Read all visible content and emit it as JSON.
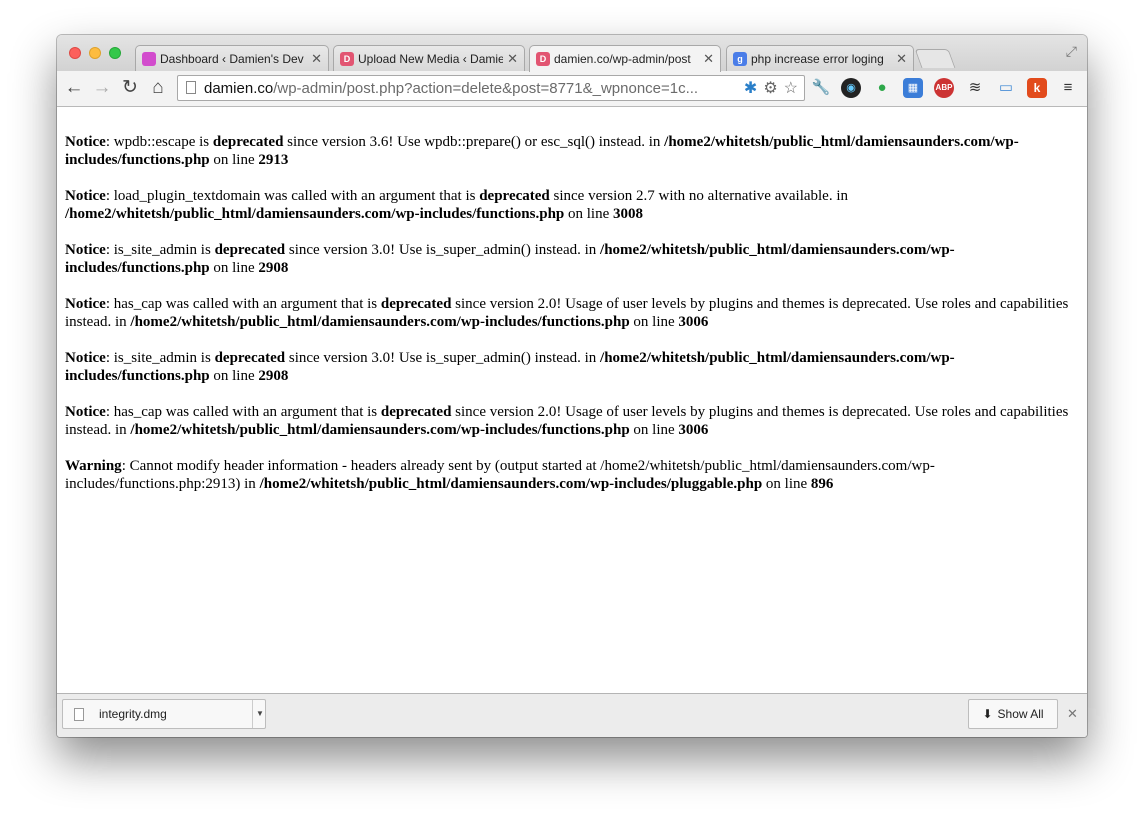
{
  "tabs": [
    {
      "title": "Dashboard ‹ Damien's Dev",
      "favicon": "wordpress-purple-icon",
      "color": "#d24ccd",
      "letter": ""
    },
    {
      "title": "Upload New Media ‹ Damie",
      "favicon": "damien-d-icon",
      "color": "#e25572",
      "letter": "D"
    },
    {
      "title": "damien.co/wp-admin/post",
      "favicon": "damien-d-icon",
      "color": "#e25572",
      "letter": "D",
      "active": true
    },
    {
      "title": "php increase error loging",
      "favicon": "google-icon",
      "color": "#4a7de8",
      "letter": "g"
    }
  ],
  "address": {
    "host": "damien.co",
    "path": "/wp-admin/post.php?action=delete&post=8771&_wpnonce=1c..."
  },
  "messages": [
    {
      "parts": [
        {
          "t": "Notice",
          "b": true
        },
        {
          "t": ": wpdb::escape is "
        },
        {
          "t": "deprecated",
          "b": true
        },
        {
          "t": " since version 3.6! Use wpdb::prepare() or esc_sql() instead. in "
        },
        {
          "t": "/home2/whitetsh/public_html/damiensaunders.com/wp-includes/functions.php",
          "b": true
        },
        {
          "t": " on line "
        },
        {
          "t": "2913",
          "b": true
        }
      ]
    },
    {
      "parts": [
        {
          "t": "Notice",
          "b": true
        },
        {
          "t": ": load_plugin_textdomain was called with an argument that is "
        },
        {
          "t": "deprecated",
          "b": true
        },
        {
          "t": " since version 2.7 with no alternative available. in "
        },
        {
          "t": "/home2/whitetsh/public_html/damiensaunders.com/wp-includes/functions.php",
          "b": true
        },
        {
          "t": " on line "
        },
        {
          "t": "3008",
          "b": true
        }
      ]
    },
    {
      "parts": [
        {
          "t": "Notice",
          "b": true
        },
        {
          "t": ": is_site_admin is "
        },
        {
          "t": "deprecated",
          "b": true
        },
        {
          "t": " since version 3.0! Use is_super_admin() instead. in "
        },
        {
          "t": "/home2/whitetsh/public_html/damiensaunders.com/wp-includes/functions.php",
          "b": true
        },
        {
          "t": " on line "
        },
        {
          "t": "2908",
          "b": true
        }
      ]
    },
    {
      "parts": [
        {
          "t": "Notice",
          "b": true
        },
        {
          "t": ": has_cap was called with an argument that is "
        },
        {
          "t": "deprecated",
          "b": true
        },
        {
          "t": " since version 2.0! Usage of user levels by plugins and themes is deprecated. Use roles and capabilities instead. in "
        },
        {
          "t": "/home2/whitetsh/public_html/damiensaunders.com/wp-includes/functions.php",
          "b": true
        },
        {
          "t": " on line "
        },
        {
          "t": "3006",
          "b": true
        }
      ]
    },
    {
      "parts": [
        {
          "t": "Notice",
          "b": true
        },
        {
          "t": ": is_site_admin is "
        },
        {
          "t": "deprecated",
          "b": true
        },
        {
          "t": " since version 3.0! Use is_super_admin() instead. in "
        },
        {
          "t": "/home2/whitetsh/public_html/damiensaunders.com/wp-includes/functions.php",
          "b": true
        },
        {
          "t": " on line "
        },
        {
          "t": "2908",
          "b": true
        }
      ]
    },
    {
      "parts": [
        {
          "t": "Notice",
          "b": true
        },
        {
          "t": ": has_cap was called with an argument that is "
        },
        {
          "t": "deprecated",
          "b": true
        },
        {
          "t": " since version 2.0! Usage of user levels by plugins and themes is deprecated. Use roles and capabilities instead. in "
        },
        {
          "t": "/home2/whitetsh/public_html/damiensaunders.com/wp-includes/functions.php",
          "b": true
        },
        {
          "t": " on line "
        },
        {
          "t": "3006",
          "b": true
        }
      ]
    },
    {
      "parts": [
        {
          "t": "Warning",
          "b": true
        },
        {
          "t": ": Cannot modify header information - headers already sent by (output started at /home2/whitetsh/public_html/damiensaunders.com/wp-includes/functions.php:2913) in "
        },
        {
          "t": "/home2/whitetsh/public_html/damiensaunders.com/wp-includes/pluggable.php",
          "b": true
        },
        {
          "t": " on line "
        },
        {
          "t": "896",
          "b": true
        }
      ]
    }
  ],
  "download": {
    "filename": "integrity.dmg",
    "show_all_label": "Show All"
  },
  "extensions": [
    "wrench-icon",
    "color-picker-icon",
    "hangouts-icon",
    "calendar-icon",
    "adblock-plus-icon",
    "buffer-icon",
    "folder-icon",
    "klout-icon",
    "menu-icon"
  ]
}
